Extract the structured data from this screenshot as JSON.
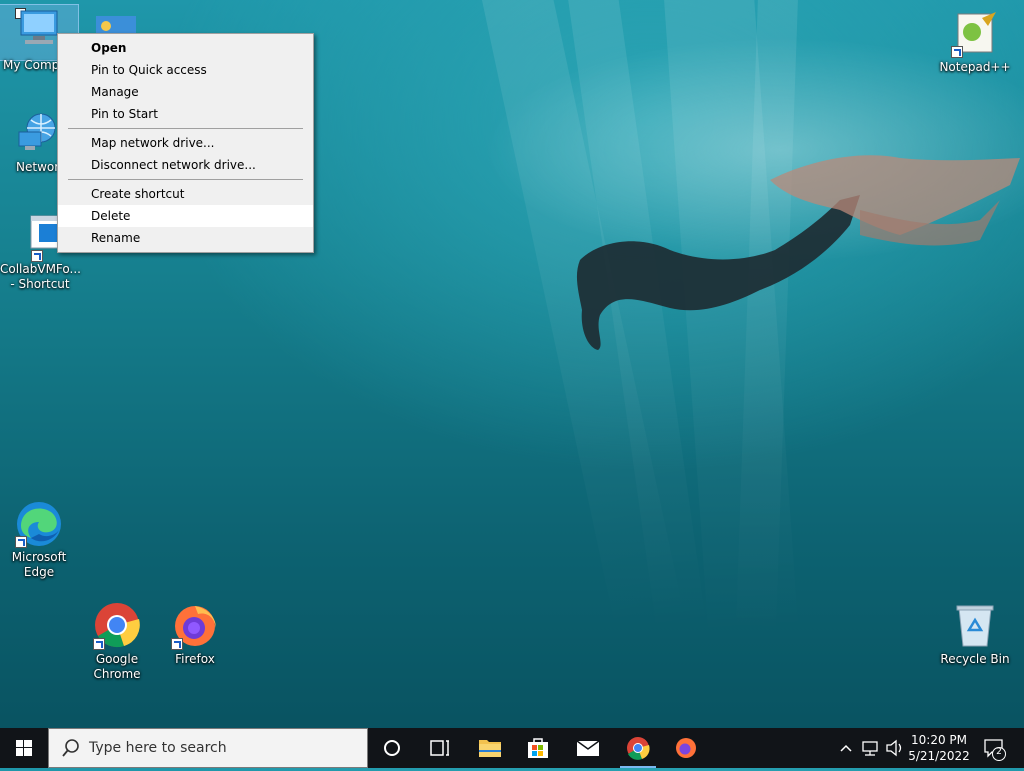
{
  "desktop": {
    "icons": [
      {
        "label": "My Comp",
        "name": "my-computer"
      },
      {
        "label": "Networ",
        "name": "network"
      },
      {
        "label": "CollabVMFo... - Shortcut",
        "name": "collabvm-shortcut"
      },
      {
        "label": "Microsoft Edge",
        "name": "microsoft-edge"
      },
      {
        "label": "Google Chrome",
        "name": "google-chrome"
      },
      {
        "label": "Firefox",
        "name": "firefox"
      },
      {
        "label": "Notepad++",
        "name": "notepad-plus-plus"
      },
      {
        "label": "Recycle Bin",
        "name": "recycle-bin"
      }
    ]
  },
  "context_menu": {
    "open": "Open",
    "pin_quick_access": "Pin to Quick access",
    "manage": "Manage",
    "pin_start": "Pin to Start",
    "map_drive": "Map network drive...",
    "disconnect_drive": "Disconnect network drive...",
    "create_shortcut": "Create shortcut",
    "delete": "Delete",
    "rename": "Rename"
  },
  "taskbar": {
    "search_placeholder": "Type here to search",
    "time": "10:20 PM",
    "date": "5/21/2022",
    "notification_count": "2"
  },
  "colors": {
    "taskbar_bg": "#111418",
    "menu_bg": "#f0f0f0",
    "accent": "#7ab7f0"
  }
}
